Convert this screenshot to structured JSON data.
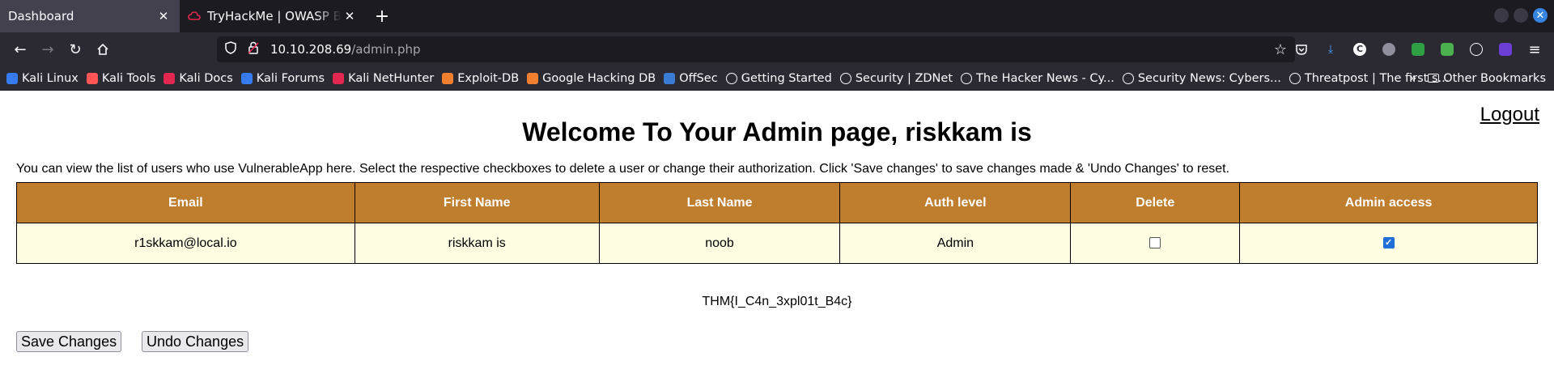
{
  "browser": {
    "tabs": [
      {
        "title": "Dashboard",
        "active": true
      },
      {
        "title": "TryHackMe | OWASP Brok",
        "active": false
      }
    ],
    "url": {
      "host": "10.10.208.69",
      "path": "/admin.php"
    },
    "bookmarks": [
      {
        "label": "Kali Linux",
        "icon": "kali-icon",
        "color": "#367bf0"
      },
      {
        "label": "Kali Tools",
        "icon": "kali-icon",
        "color": "#ff5555"
      },
      {
        "label": "Kali Docs",
        "icon": "kali-docs-icon",
        "color": "#e22850"
      },
      {
        "label": "Kali Forums",
        "icon": "kali-forums-icon",
        "color": "#367bf0"
      },
      {
        "label": "Kali NetHunter",
        "icon": "nethunter-icon",
        "color": "#e22850"
      },
      {
        "label": "Exploit-DB",
        "icon": "exploitdb-icon",
        "color": "#f08030"
      },
      {
        "label": "Google Hacking DB",
        "icon": "ghdb-icon",
        "color": "#f08030"
      },
      {
        "label": "OffSec",
        "icon": "offsec-icon",
        "color": "#3a7bd5"
      },
      {
        "label": "Getting Started",
        "icon": "globe-icon",
        "color": ""
      },
      {
        "label": "Security | ZDNet",
        "icon": "globe-icon",
        "color": ""
      },
      {
        "label": "The Hacker News - Cy...",
        "icon": "globe-icon",
        "color": ""
      },
      {
        "label": "Security News: Cybers...",
        "icon": "globe-icon",
        "color": ""
      },
      {
        "label": "Threatpost | The first s...",
        "icon": "globe-icon",
        "color": ""
      }
    ],
    "other_bookmarks": "Other Bookmarks",
    "more_bookmarks": "»"
  },
  "page": {
    "logout": "Logout",
    "title": "Welcome To Your Admin page, riskkam is",
    "description": "You can view the list of users who use VulnerableApp here. Select the respective checkboxes to delete a user or change their authorization. Click 'Save changes' to save changes made & 'Undo Changes' to reset.",
    "table": {
      "headers": [
        "Email",
        "First Name",
        "Last Name",
        "Auth level",
        "Delete",
        "Admin access"
      ],
      "rows": [
        {
          "email": "r1skkam@local.io",
          "first_name": "riskkam is",
          "last_name": "noob",
          "auth_level": "Admin",
          "delete": false,
          "admin_access": true
        }
      ]
    },
    "flag": "THM{I_C4n_3xpl01t_B4c}",
    "save_button": "Save Changes",
    "undo_button": "Undo Changes"
  },
  "colors": {
    "table_header": "#bf7d2e",
    "table_row": "#fffde1"
  }
}
